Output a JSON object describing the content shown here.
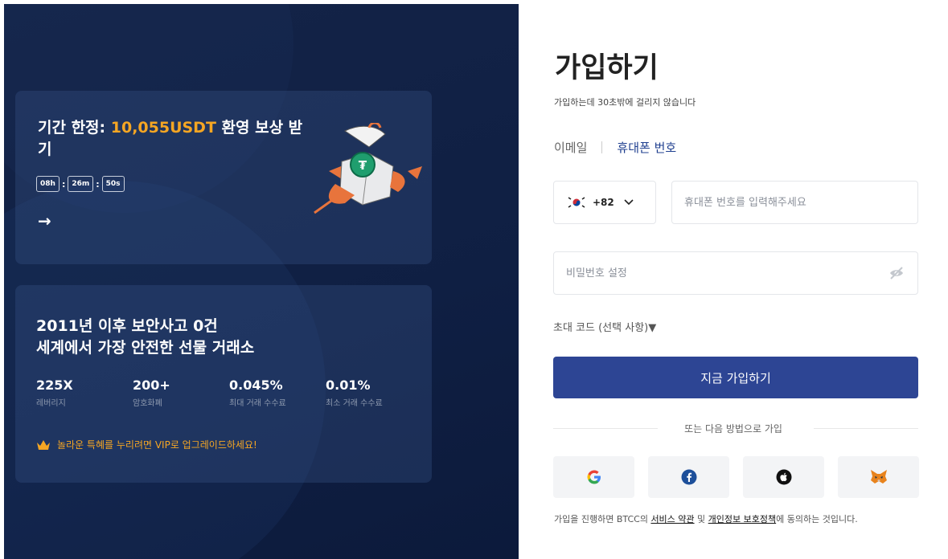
{
  "promo": {
    "title_prefix": "기간 한정: ",
    "title_highlight": "10,055USDT",
    "title_suffix": " 환영 보상 받기",
    "timer": {
      "hours": "08h",
      "minutes": "26m",
      "seconds": "50s",
      "separator": ":"
    },
    "arrow": "→"
  },
  "security": {
    "title_line1": "2011년 이후 보안사고 0건",
    "title_line2": "세계에서 가장 안전한 선물 거래소",
    "stats": [
      {
        "value": "225X",
        "label": "레버리지"
      },
      {
        "value": "200+",
        "label": "암호화폐"
      },
      {
        "value": "0.045%",
        "label": "최대 거래 수수료"
      },
      {
        "value": "0.01%",
        "label": "최소 거래 수수료"
      }
    ],
    "vip_text": "놀라운 특혜를 누리려면 VIP로 업그레이드하세요!"
  },
  "signup": {
    "title": "가입하기",
    "subtitle": "가입하는데 30초밖에 걸리지 않습니다",
    "tabs": {
      "email": "이메일",
      "phone": "휴대폰 번호"
    },
    "country_code": "+82",
    "phone_placeholder": "휴대폰 번호를 입력해주세요",
    "password_placeholder": "비밀번호 설정",
    "invite_code": "초대 코드 (선택 사항)▼",
    "submit_label": "지금 가입하기",
    "or_text": "또는 다음 방법으로 가입",
    "social_icons": [
      "google-icon",
      "facebook-icon",
      "apple-icon",
      "metamask-icon"
    ],
    "terms": {
      "prefix": "가입을 진행하면 BTCC의 ",
      "service_link": "서비스 약관",
      "middle": " 및 ",
      "privacy_link": "개인정보 보호정책",
      "suffix": "에 동의하는 것입니다."
    }
  },
  "colors": {
    "accent": "#2d4594",
    "highlight": "#f5a623",
    "left_bg": "#0f1f43",
    "tab_active": "#1f3f8f"
  }
}
